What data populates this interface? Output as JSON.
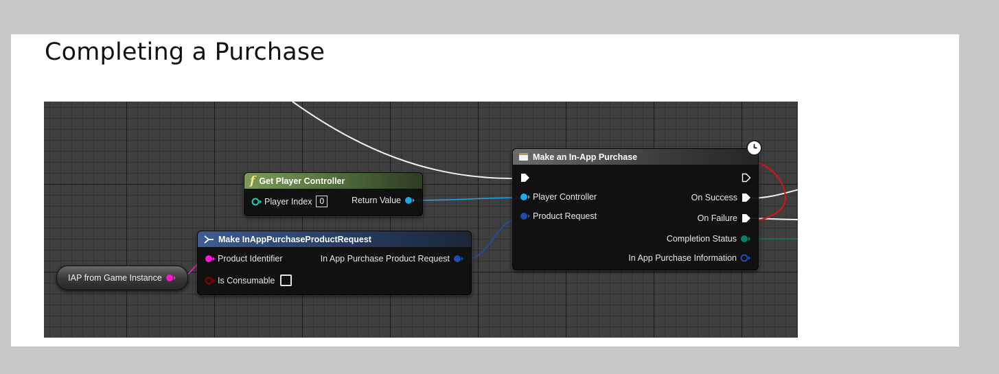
{
  "page": {
    "title": "Completing a Purchase"
  },
  "graph": {
    "get_player_controller": {
      "title": "Get Player Controller",
      "function_glyph": "f",
      "input_label": "Player Index",
      "input_value": "0",
      "output_label": "Return Value"
    },
    "make_request": {
      "title": "Make InAppPurchaseProductRequest",
      "product_identifier": "Product Identifier",
      "is_consumable": "Is Consumable",
      "output_label": "In App Purchase Product Request"
    },
    "iap_variable": {
      "label": "IAP from Game Instance"
    },
    "make_purchase": {
      "title": "Make an In-App Purchase",
      "player_controller": "Player Controller",
      "product_request": "Product Request",
      "on_success": "On Success",
      "on_failure": "On Failure",
      "completion_status": "Completion Status",
      "purchase_information": "In App Purchase Information"
    }
  },
  "colors": {
    "object_pin": "#1fa8e8",
    "struct_pin": "#1a4fb5",
    "string_pin": "#ff16d6",
    "bool_pin": "#8a0000",
    "enum_pin": "#0d7f6a",
    "annotation": "#e01010"
  },
  "icons": [
    "function-icon",
    "struct-make-icon",
    "latent-clock-icon",
    "exec-pin-icon"
  ]
}
